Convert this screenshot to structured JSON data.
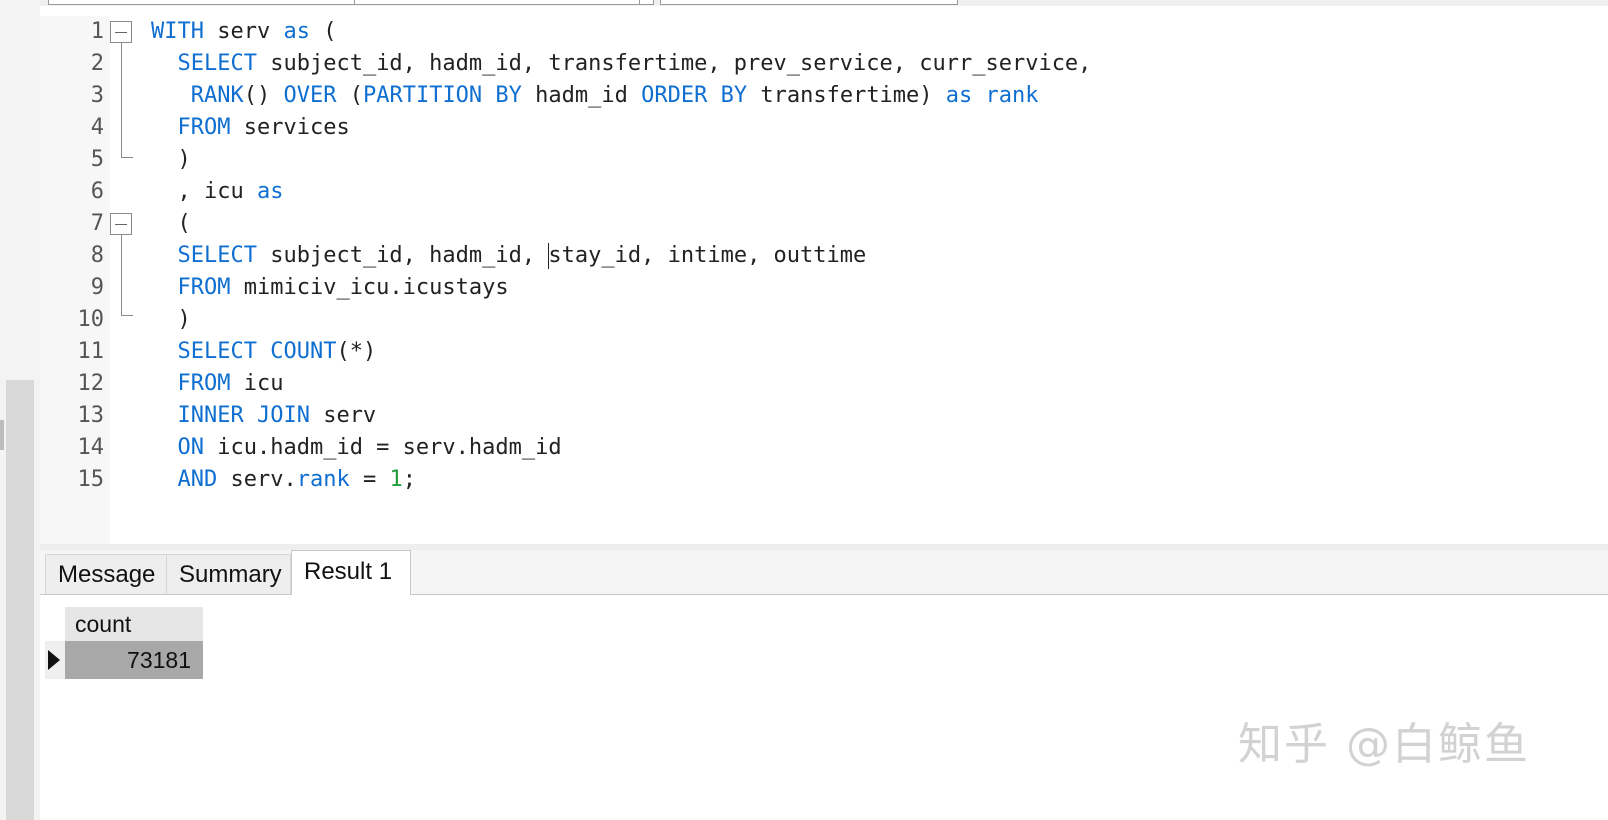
{
  "editor": {
    "line_numbers": [
      "1",
      "2",
      "3",
      "4",
      "5",
      "6",
      "7",
      "8",
      "9",
      "10",
      "11",
      "12",
      "13",
      "14",
      "15"
    ]
  },
  "results": {
    "tabs": [
      {
        "label": "Message"
      },
      {
        "label": "Summary"
      },
      {
        "label": "Result 1"
      }
    ],
    "active_tab": "Result 1",
    "columns": [
      "count"
    ],
    "rows": [
      [
        "73181"
      ]
    ]
  },
  "watermark": "知乎 @白鲸鱼",
  "colors": {
    "keyword": "#0f6fd1",
    "number": "#1f9e3a",
    "text": "#222222"
  }
}
